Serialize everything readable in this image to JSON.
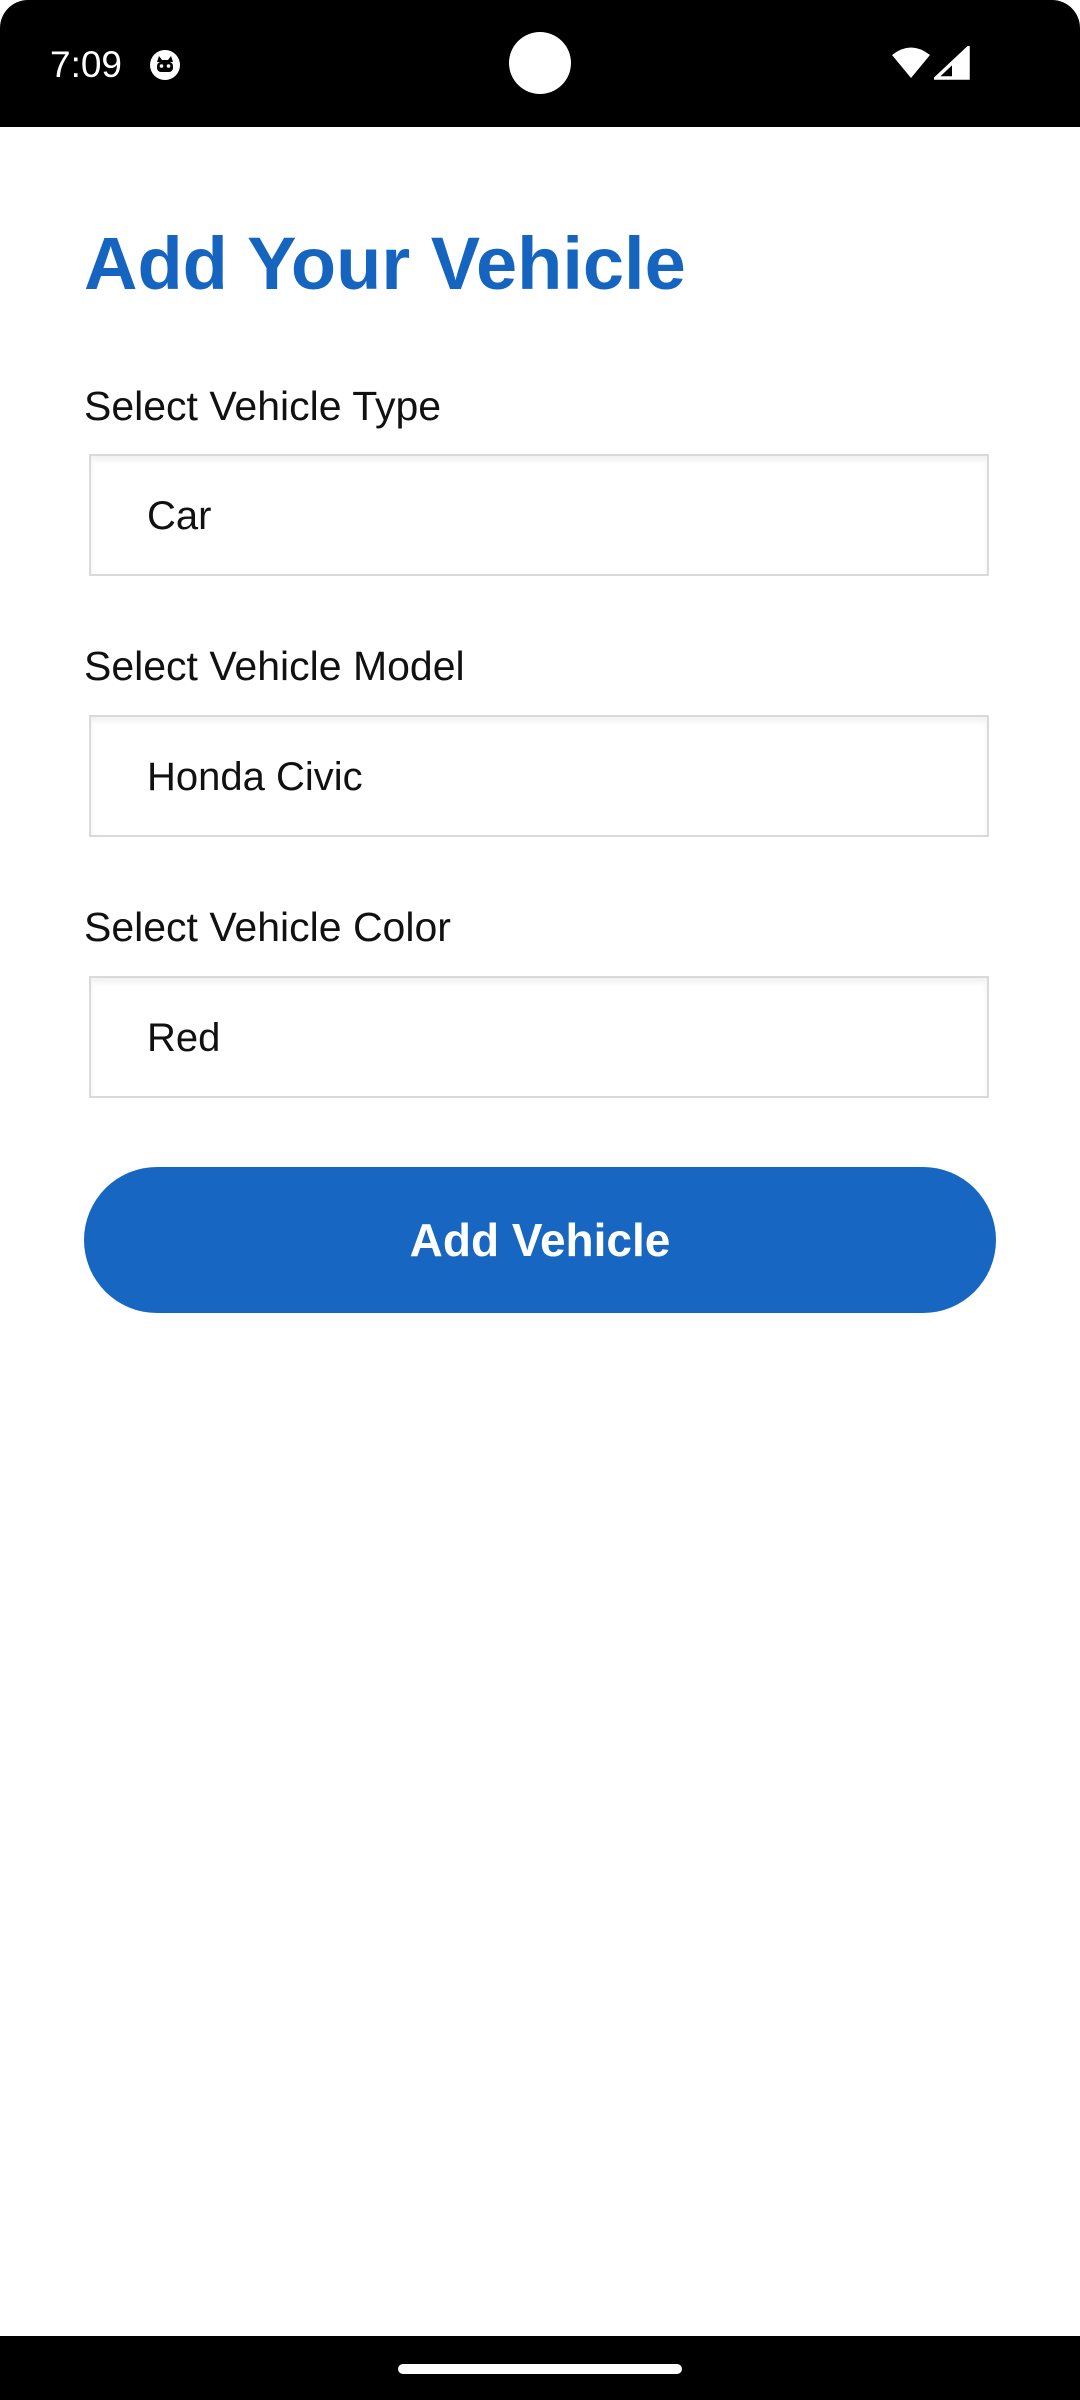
{
  "status_bar": {
    "time": "7:09",
    "icons": [
      "app-notification-icon",
      "camera-cutout",
      "wifi-icon",
      "cellular-signal-icon"
    ]
  },
  "page": {
    "title": "Add Your Vehicle"
  },
  "form": {
    "fields": [
      {
        "label": "Select Vehicle Type",
        "value": "Car"
      },
      {
        "label": "Select Vehicle Model",
        "value": "Honda Civic"
      },
      {
        "label": "Select Vehicle Color",
        "value": "Red"
      }
    ],
    "submit_label": "Add Vehicle"
  },
  "colors": {
    "accent": "#1565c0",
    "button": "#1766c2",
    "status_bar": "#000000",
    "background": "#ffffff"
  }
}
